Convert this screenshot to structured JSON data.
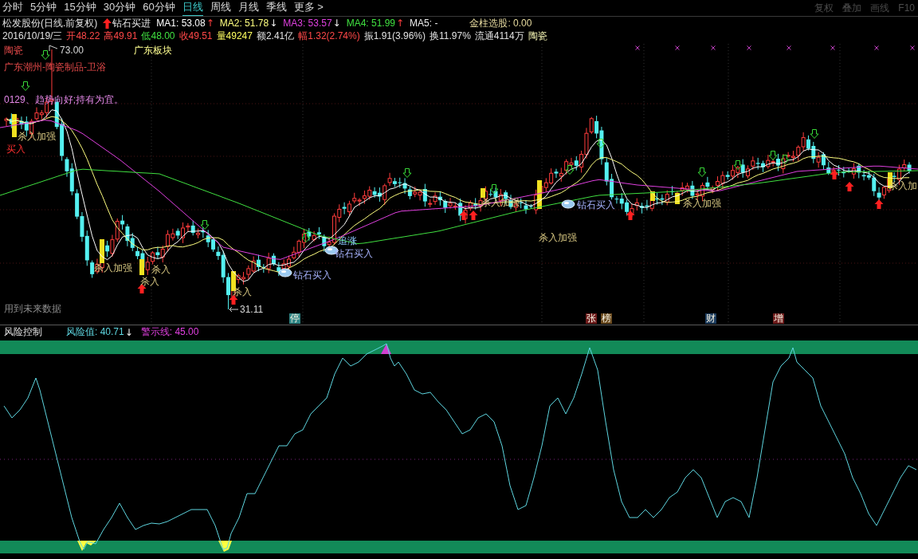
{
  "toolbar": {
    "tabs": [
      {
        "label": "分时",
        "selected": false
      },
      {
        "label": "5分钟",
        "selected": false
      },
      {
        "label": "15分钟",
        "selected": false
      },
      {
        "label": "30分钟",
        "selected": false
      },
      {
        "label": "60分钟",
        "selected": false
      },
      {
        "label": "日线",
        "selected": true
      },
      {
        "label": "周线",
        "selected": false
      },
      {
        "label": "月线",
        "selected": false
      },
      {
        "label": "季线",
        "selected": false
      },
      {
        "label": "更多 >",
        "selected": false
      }
    ],
    "tools": [
      "复权",
      "叠加",
      "画线",
      "F10"
    ]
  },
  "main_panel": {
    "title": "松发股份(日线.前复权)",
    "signal": "钻石买进",
    "indicators": [
      {
        "label": "MA1: 53.08",
        "arrow": {
          "text": "↑",
          "kind": "up"
        },
        "color": "#ffffff"
      },
      {
        "label": "MA2: 51.78",
        "arrow": {
          "text": "↓",
          "kind": "down"
        },
        "color": "#ffff80"
      },
      {
        "label": "MA3: 53.57",
        "arrow": {
          "text": "↓",
          "kind": "down"
        },
        "color": "#e040e0"
      },
      {
        "label": "MA4: 51.99",
        "arrow": {
          "text": "↑",
          "kind": "up"
        },
        "color": "#40e040"
      },
      {
        "label": "MA5: -",
        "color": "#e8e8e8"
      }
    ],
    "selection": "金柱选股: 0.00",
    "quote": [
      {
        "text": "2016/10/19/三",
        "kind": "plain"
      },
      {
        "text": "开48.22",
        "kind": "rise"
      },
      {
        "text": "高49.91",
        "kind": "rise"
      },
      {
        "text": "低48.00",
        "kind": "fall"
      },
      {
        "text": "收49.51",
        "kind": "rise"
      },
      {
        "text": "量49247",
        "kind": "volume"
      },
      {
        "text": "额2.41亿",
        "kind": "plain"
      },
      {
        "text": "幅1.32(2.74%)",
        "kind": "rise"
      },
      {
        "text": "振1.91(3.96%)",
        "kind": "plain"
      },
      {
        "text": "换11.97%",
        "kind": "plain"
      },
      {
        "text": "流通4114万",
        "kind": "plain"
      },
      {
        "text": "陶瓷",
        "kind": "sector"
      }
    ],
    "tags": [
      {
        "text": "陶瓷",
        "kind": "industry"
      },
      {
        "text": "广东板块",
        "kind": "region"
      },
      {
        "text": "广东潮州-陶瓷制品-卫浴",
        "kind": "industry"
      },
      {
        "text": "0129、趋势向好;持有为宜。",
        "kind": "comment"
      },
      {
        "text": "用到未来数据",
        "kind": "note"
      }
    ],
    "price_marks": [
      {
        "text": "73.00",
        "kind": "high"
      },
      {
        "text": "31.11",
        "kind": "low"
      }
    ],
    "signals": [
      {
        "text": "杀入加强",
        "kind": "strong"
      },
      {
        "text": "买入",
        "kind": "buy"
      },
      {
        "text": "杀入加强",
        "kind": "strong"
      },
      {
        "text": "杀入",
        "kind": "strong"
      },
      {
        "text": "杀入",
        "kind": "strong"
      },
      {
        "text": "杀入",
        "kind": "strong"
      },
      {
        "text": "钻石买入",
        "kind": "diamond"
      },
      {
        "text": "追涨",
        "kind": "chase"
      },
      {
        "text": "钻石买入",
        "kind": "diamond"
      },
      {
        "text": "杀入加强",
        "kind": "strong"
      },
      {
        "text": "杀入加强",
        "kind": "strong"
      },
      {
        "text": "钻石买入",
        "kind": "diamond"
      },
      {
        "text": "杀入加强",
        "kind": "strong"
      },
      {
        "text": "杀入加",
        "kind": "strong"
      }
    ],
    "events": [
      {
        "text": "停",
        "color": "#2f8585"
      },
      {
        "text": "张",
        "color": "#6e1c1c"
      },
      {
        "text": "榜",
        "color": "#6a4a1e"
      },
      {
        "text": "财",
        "color": "#1c3c5e"
      },
      {
        "text": "增",
        "color": "#6e1c1c"
      }
    ]
  },
  "risk_panel": {
    "title": "风险控制",
    "lines": [
      {
        "label": "风险值: 40.71",
        "arrow": {
          "text": "↓",
          "kind": "down"
        },
        "color": "#5ed6e0"
      },
      {
        "label": "警示线: 45.00",
        "color": "#e040e0"
      }
    ]
  }
}
